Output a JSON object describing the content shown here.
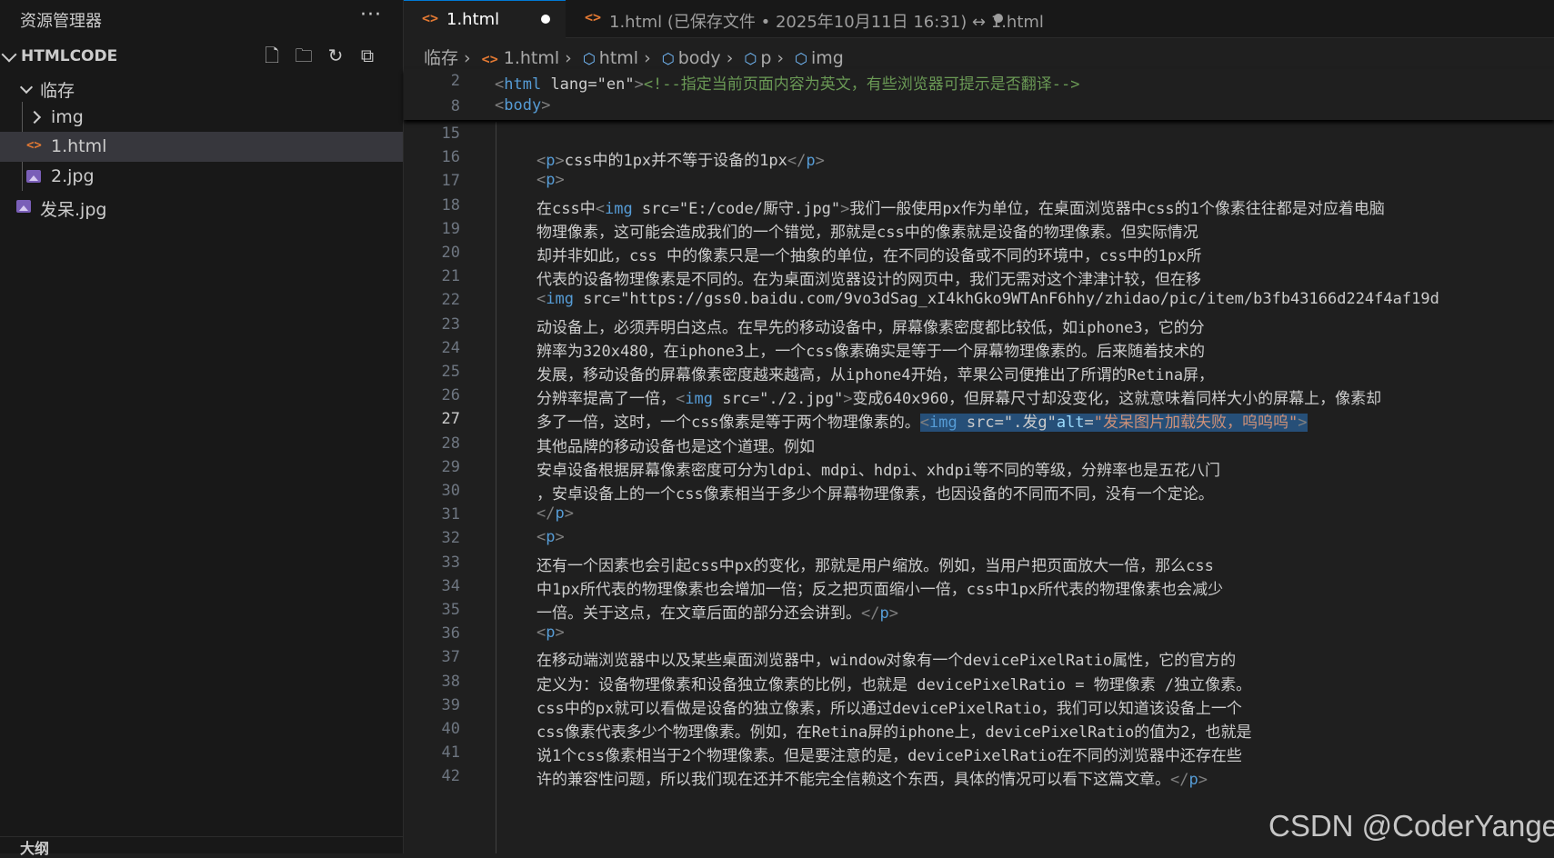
{
  "sidebar": {
    "title": "资源管理器",
    "more": "···",
    "section": "HTMLCODE",
    "items": [
      {
        "label": "临存",
        "type": "folder-open"
      },
      {
        "label": "img",
        "type": "folder-closed"
      },
      {
        "label": "1.html",
        "type": "html-file",
        "selected": true
      },
      {
        "label": "2.jpg",
        "type": "image-file"
      },
      {
        "label": "发呆.jpg",
        "type": "image-file"
      }
    ],
    "outline": "大纲"
  },
  "tabs": [
    {
      "label": "1.html",
      "active": true
    },
    {
      "label": "1.html (已保存文件 • 2025年10月11日 16:31) ↔ 1.html",
      "active": false
    }
  ],
  "breadcrumb": [
    "临存",
    "1.html",
    "html",
    "body",
    "p",
    "img"
  ],
  "sticky": [
    {
      "num": "2",
      "text": "<html lang=\"en\"><!--指定当前页面内容为英文，有些浏览器可提示是否翻译-->"
    },
    {
      "num": "8",
      "text": "<body>"
    }
  ],
  "lines": [
    {
      "num": "15",
      "text": ""
    },
    {
      "num": "16",
      "text": "<p>css中的1px并不等于设备的1px</p>"
    },
    {
      "num": "17",
      "text": "<p>"
    },
    {
      "num": "18",
      "text": "在css中<img src=\"E:/code/厮守.jpg\">我们一般使用px作为单位，在桌面浏览器中css的1个像素往往都是对应着电脑"
    },
    {
      "num": "19",
      "text": "物理像素，这可能会造成我们的一个错觉，那就是css中的像素就是设备的物理像素。但实际情况"
    },
    {
      "num": "20",
      "text": "却并非如此，css 中的像素只是一个抽象的单位，在不同的设备或不同的环境中，css中的1px所"
    },
    {
      "num": "21",
      "text": "代表的设备物理像素是不同的。在为桌面浏览器设计的网页中，我们无需对这个津津计较，但在移"
    },
    {
      "num": "22",
      "text": "<img src=\"https://gss0.baidu.com/9vo3dSag_xI4khGko9WTAnF6hhy/zhidao/pic/item/b3fb43166d224f4af19d"
    },
    {
      "num": "23",
      "text": "动设备上，必须弄明白这点。在早先的移动设备中，屏幕像素密度都比较低，如iphone3，它的分"
    },
    {
      "num": "24",
      "text": "辨率为320x480，在iphone3上，一个css像素确实是等于一个屏幕物理像素的。后来随着技术的"
    },
    {
      "num": "25",
      "text": "发展，移动设备的屏幕像素密度越来越高，从iphone4开始，苹果公司便推出了所谓的Retina屏，"
    },
    {
      "num": "26",
      "text": "分辨率提高了一倍，<img src=\"./2.jpg\">变成640x960，但屏幕尺寸却没变化，这就意味着同样大小的屏幕上，像素却"
    },
    {
      "num": "27",
      "text": "多了一倍，这时，一个css像素是等于两个物理像素的。<img src=\".发g\"alt=\"发呆图片加载失败，呜呜呜\">"
    },
    {
      "num": "28",
      "text": "其他品牌的移动设备也是这个道理。例如"
    },
    {
      "num": "29",
      "text": "安卓设备根据屏幕像素密度可分为ldpi、mdpi、hdpi、xhdpi等不同的等级，分辨率也是五花八门"
    },
    {
      "num": "30",
      "text": "，安卓设备上的一个css像素相当于多少个屏幕物理像素，也因设备的不同而不同，没有一个定论。"
    },
    {
      "num": "31",
      "text": "</p>"
    },
    {
      "num": "32",
      "text": "<p>"
    },
    {
      "num": "33",
      "text": "还有一个因素也会引起css中px的变化，那就是用户缩放。例如，当用户把页面放大一倍，那么css"
    },
    {
      "num": "34",
      "text": "中1px所代表的物理像素也会增加一倍；反之把页面缩小一倍，css中1px所代表的物理像素也会减少"
    },
    {
      "num": "35",
      "text": "一倍。关于这点，在文章后面的部分还会讲到。</p>"
    },
    {
      "num": "36",
      "text": "<p>"
    },
    {
      "num": "37",
      "text": "在移动端浏览器中以及某些桌面浏览器中，window对象有一个devicePixelRatio属性，它的官方的"
    },
    {
      "num": "38",
      "text": "定义为：设备物理像素和设备独立像素的比例，也就是 devicePixelRatio = 物理像素 /独立像素。"
    },
    {
      "num": "39",
      "text": "css中的px就可以看做是设备的独立像素，所以通过devicePixelRatio，我们可以知道该设备上一个"
    },
    {
      "num": "40",
      "text": "css像素代表多少个物理像素。例如，在Retina屏的iphone上，devicePixelRatio的值为2，也就是"
    },
    {
      "num": "41",
      "text": "说1个css像素相当于2个物理像素。但是要注意的是，devicePixelRatio在不同的浏览器中还存在些"
    },
    {
      "num": "42",
      "text": "许的兼容性问题，所以我们现在还并不能完全信赖这个东西，具体的情况可以看下这篇文章。</p>"
    }
  ],
  "current_line": "27",
  "watermark": "CSDN @CoderYanger",
  "colors": {
    "accent": "#0078d4",
    "tag": "#569cd6",
    "attr": "#9cdcfe",
    "string": "#ce9178",
    "comment": "#6a9955",
    "html_icon": "#e37933"
  }
}
